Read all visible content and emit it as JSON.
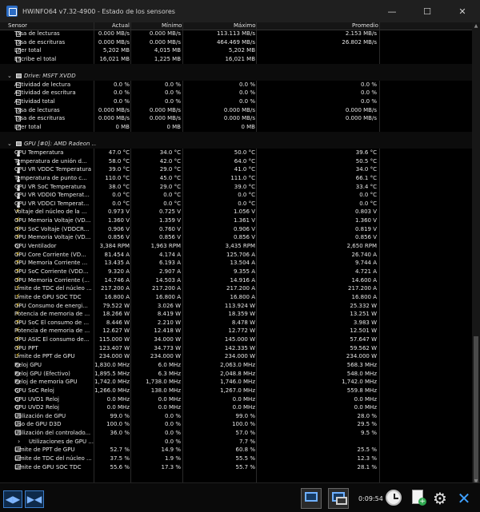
{
  "window": {
    "title": "HWiNFO64 v7.32-4900 - Estado de los sensores",
    "minimize": "—",
    "maximize": "☐",
    "close": "✕"
  },
  "columns": {
    "sensor": "Sensor",
    "current": "Actual",
    "min": "Mínimo",
    "max": "Máximo",
    "avg": "Promedio"
  },
  "rows": [
    {
      "type": "item",
      "icon": "doc",
      "name": "Tasa de lecturas",
      "cur": "0.000 MB/s",
      "min": "0.000 MB/s",
      "max": "113.113 MB/s",
      "avg": "2.153 MB/s"
    },
    {
      "type": "item",
      "icon": "doc",
      "name": "Tasa de escrituras",
      "cur": "0.000 MB/s",
      "min": "0.000 MB/s",
      "max": "464.469 MB/s",
      "avg": "26.802 MB/s"
    },
    {
      "type": "item",
      "icon": "doc",
      "name": "Leer total",
      "cur": "5,202 MB",
      "min": "4,015 MB",
      "max": "5,202 MB",
      "avg": ""
    },
    {
      "type": "item",
      "icon": "doc",
      "name": "Escribe el total",
      "cur": "16,021 MB",
      "min": "1,225 MB",
      "max": "16,021 MB",
      "avg": ""
    },
    {
      "type": "sep"
    },
    {
      "type": "group",
      "name": "Drive: MSFT XVDD"
    },
    {
      "type": "item",
      "icon": "doc",
      "name": "Actividad de lectura",
      "cur": "0.0 %",
      "min": "0.0 %",
      "max": "0.0 %",
      "avg": "0.0 %"
    },
    {
      "type": "item",
      "icon": "doc",
      "name": "Actividad de escritura",
      "cur": "0.0 %",
      "min": "0.0 %",
      "max": "0.0 %",
      "avg": "0.0 %"
    },
    {
      "type": "item",
      "icon": "doc",
      "name": "Actividad total",
      "cur": "0.0 %",
      "min": "0.0 %",
      "max": "0.0 %",
      "avg": "0.0 %"
    },
    {
      "type": "item",
      "icon": "doc",
      "name": "Tasa de lecturas",
      "cur": "0.000 MB/s",
      "min": "0.000 MB/s",
      "max": "0.000 MB/s",
      "avg": "0.000 MB/s"
    },
    {
      "type": "item",
      "icon": "doc",
      "name": "Tasa de escrituras",
      "cur": "0.000 MB/s",
      "min": "0.000 MB/s",
      "max": "0.000 MB/s",
      "avg": "0.000 MB/s"
    },
    {
      "type": "item",
      "icon": "doc",
      "name": "Leer total",
      "cur": "0 MB",
      "min": "0 MB",
      "max": "0 MB",
      "avg": ""
    },
    {
      "type": "sep"
    },
    {
      "type": "group",
      "name": "GPU [#0]: AMD Radeon ..."
    },
    {
      "type": "item",
      "icon": "therm",
      "name": "GPU Temperatura",
      "cur": "47.0 °C",
      "min": "34.0 °C",
      "max": "50.0 °C",
      "avg": "39.6 °C"
    },
    {
      "type": "item",
      "icon": "therm",
      "name": "Temperatura de unión d...",
      "cur": "58.0 °C",
      "min": "42.0 °C",
      "max": "64.0 °C",
      "avg": "50.5 °C"
    },
    {
      "type": "item",
      "icon": "therm",
      "name": "GPU VR VDDC Temperatura",
      "cur": "39.0 °C",
      "min": "29.0 °C",
      "max": "41.0 °C",
      "avg": "34.0 °C"
    },
    {
      "type": "item",
      "icon": "therm",
      "name": "Temperatura de punto c...",
      "cur": "110.0 °C",
      "min": "45.0 °C",
      "max": "111.0 °C",
      "avg": "66.1 °C"
    },
    {
      "type": "item",
      "icon": "therm",
      "name": "GPU VR SoC Temperatura",
      "cur": "38.0 °C",
      "min": "29.0 °C",
      "max": "39.0 °C",
      "avg": "33.4 °C"
    },
    {
      "type": "item",
      "icon": "therm",
      "name": "GPU VR VDDIO Temperat...",
      "cur": "0.0 °C",
      "min": "0.0 °C",
      "max": "0.0 °C",
      "avg": "0.0 °C"
    },
    {
      "type": "item",
      "icon": "therm",
      "name": "GPU VR VDDCI Temperat...",
      "cur": "0.0 °C",
      "min": "0.0 °C",
      "max": "0.0 °C",
      "avg": "0.0 °C"
    },
    {
      "type": "item",
      "icon": "bolt",
      "name": "Voltaje del núcleo de la ...",
      "cur": "0.973 V",
      "min": "0.725 V",
      "max": "1.056 V",
      "avg": "0.803 V"
    },
    {
      "type": "item",
      "icon": "bolt",
      "name": "GPU Memoria Voltaje (VD...",
      "cur": "1.360 V",
      "min": "1.359 V",
      "max": "1.361 V",
      "avg": "1.360 V"
    },
    {
      "type": "item",
      "icon": "bolt",
      "name": "GPU SoC Voltaje (VDDCR...",
      "cur": "0.906 V",
      "min": "0.760 V",
      "max": "0.906 V",
      "avg": "0.819 V"
    },
    {
      "type": "item",
      "icon": "bolt",
      "name": "GPU Memoria Voltaje (VD...",
      "cur": "0.856 V",
      "min": "0.856 V",
      "max": "0.856 V",
      "avg": "0.856 V"
    },
    {
      "type": "item",
      "icon": "fan",
      "name": "GPU Ventilador",
      "cur": "3,384 RPM",
      "min": "1,963 RPM",
      "max": "3,435 RPM",
      "avg": "2,650 RPM"
    },
    {
      "type": "item",
      "icon": "bolt",
      "name": "GPU Core Corriente (VD...",
      "cur": "81.454 A",
      "min": "4.174 A",
      "max": "125.706 A",
      "avg": "26.740 A"
    },
    {
      "type": "item",
      "icon": "bolt",
      "name": "GPU Memoria Corriente ...",
      "cur": "13.435 A",
      "min": "6.193 A",
      "max": "13.504 A",
      "avg": "9.744 A"
    },
    {
      "type": "item",
      "icon": "bolt",
      "name": "GPU SoC Corriente (VDD...",
      "cur": "9.320 A",
      "min": "2.907 A",
      "max": "9.355 A",
      "avg": "4.721 A"
    },
    {
      "type": "item",
      "icon": "bolt",
      "name": "GPU Memoria Corriente (...",
      "cur": "14.746 A",
      "min": "14.503 A",
      "max": "14.916 A",
      "avg": "14.600 A"
    },
    {
      "type": "item",
      "icon": "bolt",
      "name": "Límite de TDC del núcleo ...",
      "cur": "217.200 A",
      "min": "217.200 A",
      "max": "217.200 A",
      "avg": "217.200 A"
    },
    {
      "type": "item",
      "icon": "bolt",
      "name": "Límite de GPU SOC TDC",
      "cur": "16.800 A",
      "min": "16.800 A",
      "max": "16.800 A",
      "avg": "16.800 A"
    },
    {
      "type": "item",
      "icon": "bolt",
      "name": "GPU Consumo de energi...",
      "cur": "79.522 W",
      "min": "3.026 W",
      "max": "113.924 W",
      "avg": "25.332 W"
    },
    {
      "type": "item",
      "icon": "bolt",
      "name": "Potencia de memoria de ...",
      "cur": "18.266 W",
      "min": "8.419 W",
      "max": "18.359 W",
      "avg": "13.251 W"
    },
    {
      "type": "item",
      "icon": "bolt",
      "name": "GPU SoC El consumo de ...",
      "cur": "8.446 W",
      "min": "2.210 W",
      "max": "8.478 W",
      "avg": "3.983 W"
    },
    {
      "type": "item",
      "icon": "bolt",
      "name": "Potencia de memoria de ...",
      "cur": "12.627 W",
      "min": "12.418 W",
      "max": "12.772 W",
      "avg": "12.501 W"
    },
    {
      "type": "item",
      "icon": "bolt",
      "name": "GPU ASIC El consumo de...",
      "cur": "115.000 W",
      "min": "34.000 W",
      "max": "145.000 W",
      "avg": "57.647 W"
    },
    {
      "type": "item",
      "icon": "bolt",
      "name": "GPU PPT",
      "cur": "123.407 W",
      "min": "34.773 W",
      "max": "142.335 W",
      "avg": "59.562 W"
    },
    {
      "type": "item",
      "icon": "bolt",
      "name": "Límite de PPT de GPU",
      "cur": "234.000 W",
      "min": "234.000 W",
      "max": "234.000 W",
      "avg": "234.000 W"
    },
    {
      "type": "item",
      "icon": "clock",
      "name": "Reloj GPU",
      "cur": "1,830.0 MHz",
      "min": "6.0 MHz",
      "max": "2,063.0 MHz",
      "avg": "568.3 MHz"
    },
    {
      "type": "item",
      "icon": "clock",
      "name": "Reloj GPU (Efectivo)",
      "cur": "1,895.5 MHz",
      "min": "6.3 MHz",
      "max": "2,048.8 MHz",
      "avg": "548.0 MHz"
    },
    {
      "type": "item",
      "icon": "clock",
      "name": "Reloj de memoria GPU",
      "cur": "1,742.0 MHz",
      "min": "1,738.0 MHz",
      "max": "1,746.0 MHz",
      "avg": "1,742.0 MHz"
    },
    {
      "type": "item",
      "icon": "clock",
      "name": "GPU SoC Reloj",
      "cur": "1,266.0 MHz",
      "min": "138.0 MHz",
      "max": "1,267.0 MHz",
      "avg": "559.8 MHz"
    },
    {
      "type": "item",
      "icon": "clock",
      "name": "GPU UVD1 Reloj",
      "cur": "0.0 MHz",
      "min": "0.0 MHz",
      "max": "0.0 MHz",
      "avg": "0.0 MHz"
    },
    {
      "type": "item",
      "icon": "clock",
      "name": "GPU UVD2 Reloj",
      "cur": "0.0 MHz",
      "min": "0.0 MHz",
      "max": "0.0 MHz",
      "avg": "0.0 MHz"
    },
    {
      "type": "item",
      "icon": "pct",
      "name": "Utilización de GPU",
      "cur": "99.0 %",
      "min": "0.0 %",
      "max": "99.0 %",
      "avg": "28.0 %"
    },
    {
      "type": "item",
      "icon": "pct",
      "name": "Uso de GPU D3D",
      "cur": "100.0 %",
      "min": "0.0 %",
      "max": "100.0 %",
      "avg": "29.5 %"
    },
    {
      "type": "item",
      "icon": "pct",
      "name": "Utilización del controlado...",
      "cur": "36.0 %",
      "min": "0.0 %",
      "max": "57.0 %",
      "avg": "9.5 %"
    },
    {
      "type": "item",
      "icon": "chev",
      "name": "Utilizaciones de GPU ...",
      "cur": "",
      "min": "0.0 %",
      "max": "7.7 %",
      "avg": ""
    },
    {
      "type": "item",
      "icon": "pct",
      "name": "Límite de PPT de GPU",
      "cur": "52.7 %",
      "min": "14.9 %",
      "max": "60.8 %",
      "avg": "25.5 %"
    },
    {
      "type": "item",
      "icon": "pct",
      "name": "Límite de TDC del núcleo ...",
      "cur": "37.5 %",
      "min": "1.9 %",
      "max": "55.5 %",
      "avg": "12.3 %"
    },
    {
      "type": "item",
      "icon": "pct",
      "name": "Límite de GPU SOC TDC",
      "cur": "55.6 %",
      "min": "17.3 %",
      "max": "55.7 %",
      "avg": "28.1 %"
    }
  ],
  "status": {
    "elapsed": "0:09:54"
  },
  "icons": {
    "nav_left": "◀▶",
    "nav_right": "▶◀",
    "gear": "⚙",
    "close_x": "✕",
    "plus": "+"
  }
}
